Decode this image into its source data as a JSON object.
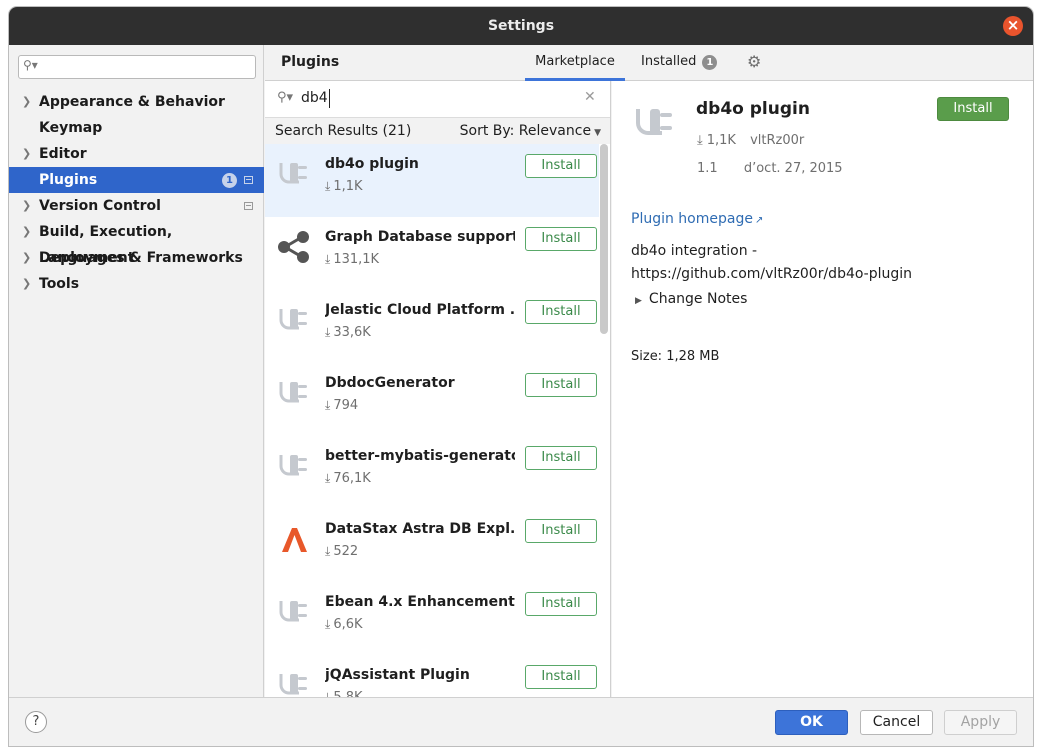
{
  "window": {
    "title": "Settings"
  },
  "sidebar": {
    "search_placeholder": "",
    "items": [
      {
        "label": "Appearance & Behavior",
        "expandable": true
      },
      {
        "label": "Keymap",
        "expandable": false
      },
      {
        "label": "Editor",
        "expandable": true
      },
      {
        "label": "Plugins",
        "expandable": false,
        "selected": true,
        "badge": "1"
      },
      {
        "label": "Version Control",
        "expandable": true
      },
      {
        "label": "Build, Execution, Deployment",
        "expandable": true
      },
      {
        "label": "Languages & Frameworks",
        "expandable": true
      },
      {
        "label": "Tools",
        "expandable": true
      }
    ]
  },
  "header": {
    "title": "Plugins",
    "tabs": [
      {
        "label": "Marketplace",
        "active": true
      },
      {
        "label": "Installed",
        "count": "1"
      }
    ]
  },
  "search": {
    "value": "db4",
    "results_label": "Search Results (21)",
    "sort_label": "Sort By: Relevance"
  },
  "plugins": [
    {
      "name": "db4o plugin",
      "downloads": "1,1K",
      "install": "Install",
      "icon": "plug-icon"
    },
    {
      "name": "Graph Database support",
      "downloads": "131,1K",
      "install": "Install",
      "icon": "share-icon"
    },
    {
      "name": "Jelastic Cloud Platform ...",
      "downloads": "33,6K",
      "install": "Install",
      "icon": "plug-icon"
    },
    {
      "name": "DbdocGenerator",
      "downloads": "794",
      "install": "Install",
      "icon": "plug-icon"
    },
    {
      "name": "better-mybatis-generator",
      "downloads": "76,1K",
      "install": "Install",
      "icon": "plug-icon"
    },
    {
      "name": "DataStax Astra DB Expl...",
      "downloads": "522",
      "install": "Install",
      "icon": "astra-icon"
    },
    {
      "name": "Ebean 4.x Enhancement",
      "downloads": "6,6K",
      "install": "Install",
      "icon": "plug-icon"
    },
    {
      "name": "jQAssistant Plugin",
      "downloads": "5,8K",
      "install": "Install",
      "icon": "plug-icon"
    }
  ],
  "detail": {
    "name": "db4o plugin",
    "install": "Install",
    "downloads": "1,1K",
    "vendor": "vltRz00r",
    "version": "1.1",
    "date": "d’oct. 27, 2015",
    "homepage": "Plugin homepage",
    "desc_line1": "db4o integration -",
    "desc_line2": "https://github.com/vltRz00r/db4o-plugin",
    "change_notes": "Change Notes",
    "size": "Size: 1,28 MB"
  },
  "footer": {
    "help": "?",
    "ok": "OK",
    "cancel": "Cancel",
    "apply": "Apply"
  },
  "colors": {
    "accent": "#2f65ca",
    "install_green": "#5a9d4b",
    "link": "#2f6cb3",
    "close": "#e9542d",
    "astra": "#e8582a"
  }
}
